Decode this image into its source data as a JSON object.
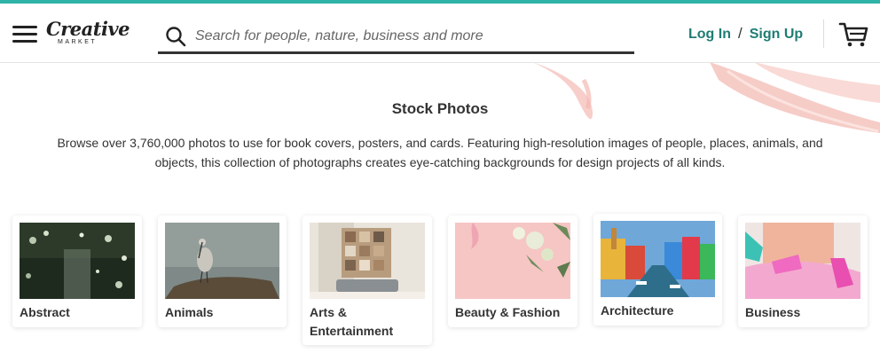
{
  "header": {
    "logo_word": "Creative",
    "logo_sub": "MARKET",
    "search_placeholder": "Search for people, nature, business and more",
    "login_label": "Log In",
    "separator": "/",
    "signup_label": "Sign Up"
  },
  "hero": {
    "title": "Stock Photos",
    "description": "Browse over 3,760,000 photos to use for book covers, posters, and cards. Featuring high-resolution images of people, places, animals, and objects, this collection of photographs creates eye-catching backgrounds for design projects of all kinds."
  },
  "categories": [
    {
      "label": "Abstract"
    },
    {
      "label": "Animals"
    },
    {
      "label": "Arts & Entertainment"
    },
    {
      "label": "Beauty & Fashion"
    },
    {
      "label": "Architecture"
    },
    {
      "label": "Business"
    }
  ],
  "colors": {
    "accent": "#2fb3a7",
    "link": "#1f7d74",
    "brush": "#f6c9c4"
  }
}
